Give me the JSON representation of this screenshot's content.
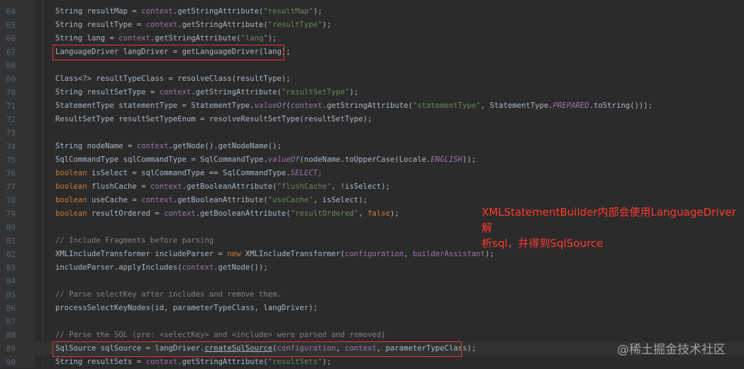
{
  "editor": {
    "line_numbers": [
      "64",
      "65",
      "66",
      "67",
      "68",
      "69",
      "70",
      "71",
      "72",
      "73",
      "74",
      "75",
      "76",
      "77",
      "78",
      "79",
      "80",
      "81",
      "82",
      "83",
      "84",
      "85",
      "86",
      "87",
      "88",
      "89",
      "90"
    ]
  },
  "code": {
    "l64": {
      "a": "String resultMap = ",
      "b": "context",
      "c": ".getStringAttribute(",
      "d": "\"resultMap\"",
      "e": ");"
    },
    "l65": {
      "a": "String resultType = ",
      "b": "context",
      "c": ".getStringAttribute(",
      "d": "\"resultType\"",
      "e": ");"
    },
    "l66": {
      "a": "String lang = ",
      "b": "context",
      "c": ".getStringAttribute(",
      "d": "\"lang\"",
      "e": ");"
    },
    "l67": {
      "a": "LanguageDriver langDriver = getLanguageDriver(lang);"
    },
    "l69": {
      "a": "Class<?> resultTypeClass = resolveClass(resultType);"
    },
    "l70": {
      "a": "String resultSetType = ",
      "b": "context",
      "c": ".getStringAttribute(",
      "d": "\"resultSetType\"",
      "e": ");"
    },
    "l71": {
      "a": "StatementType statementType = StatementType.",
      "b": "valueOf",
      "c": "(",
      "d": "context",
      "e": ".getStringAttribute(",
      "f": "\"statementType\"",
      "g": ", StatementType.",
      "h": "PREPARED",
      "i": ".toString()));"
    },
    "l72": {
      "a": "ResultSetType resultSetTypeEnum = resolveResultSetType(resultSetType);"
    },
    "l74": {
      "a": "String nodeName = ",
      "b": "context",
      "c": ".getNode().getNodeName();"
    },
    "l75": {
      "a": "SqlCommandType sqlCommandType = SqlCommandType.",
      "b": "valueOf",
      "c": "(nodeName.toUpperCase(Locale.",
      "d": "ENGLISH",
      "e": "));"
    },
    "l76": {
      "a": "boolean",
      "b": " isSelect = sqlCommandType == SqlCommandType.",
      "c": "SELECT",
      "d": ";"
    },
    "l77": {
      "a": "boolean",
      "b": " flushCache = ",
      "c": "context",
      "d": ".getBooleanAttribute(",
      "e": "\"flushCache\"",
      "f": ", !isSelect);"
    },
    "l78": {
      "a": "boolean",
      "b": " useCache = ",
      "c": "context",
      "d": ".getBooleanAttribute(",
      "e": "\"useCache\"",
      "f": ", isSelect);"
    },
    "l79": {
      "a": "boolean",
      "b": " resultOrdered = ",
      "c": "context",
      "d": ".getBooleanAttribute(",
      "e": "\"resultOrdered\"",
      "f": ", ",
      "g": "false",
      "h": ");"
    },
    "l81": {
      "a": "// Include Fragments before parsing"
    },
    "l82": {
      "a": "XMLIncludeTransformer includeParser = ",
      "b": "new",
      "c": " XMLIncludeTransformer(",
      "d": "configuration",
      "e": ", ",
      "f": "builderAssistant",
      "g": ");"
    },
    "l83": {
      "a": "includeParser.applyIncludes(",
      "b": "context",
      "c": ".getNode());"
    },
    "l85": {
      "a": "// Parse selectKey after includes and remove them."
    },
    "l86": {
      "a": "processSelectKeyNodes(id, parameterTypeClass, langDriver);"
    },
    "l88": {
      "a": "// Parse the SQL (pre: <selectKey> and <include> were parsed and removed)"
    },
    "l89": {
      "a": "SqlSource sqlSource = langDriver.",
      "b": "createSqlSource",
      "c": "(",
      "d": "configuration",
      "e": ", ",
      "f": "context",
      "g": ", parameterTypeClass);"
    },
    "l90": {
      "a": "String resultSets = ",
      "b": "context",
      "c": ".getStringAttribute(",
      "d": "\"resultSets\"",
      "e": ");"
    }
  },
  "annotation": {
    "line1": "XMLStatementBuilder内部会使用LanguageDriver解",
    "line2": "析sql，并得到SqlSource"
  },
  "watermark": "@稀土掘金技术社区",
  "colors": {
    "annotation": "#ff3a2f",
    "highlight_box": "#e53935",
    "background": "#2b2b2b"
  }
}
